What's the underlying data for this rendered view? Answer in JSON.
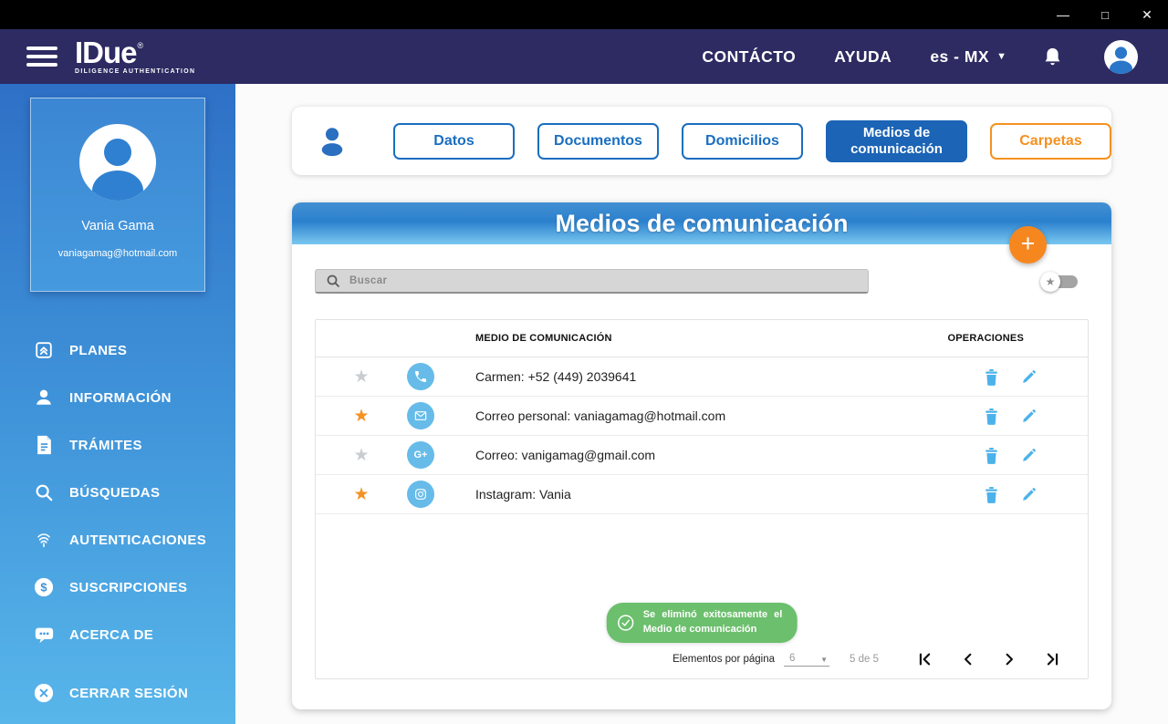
{
  "titlebar": {
    "controls": [
      {
        "name": "minimize",
        "glyph": "—"
      },
      {
        "name": "maximize",
        "glyph": "□"
      },
      {
        "name": "close",
        "glyph": "✕"
      }
    ]
  },
  "appbar": {
    "logo": {
      "title": "IDue",
      "registered": "®",
      "subtitle": "DILIGENCE AUTHENTICATION"
    },
    "nav": {
      "contact": "CONTÁCTO",
      "help": "AYUDA",
      "language": "es - MX"
    }
  },
  "sidebar": {
    "user": {
      "name": "Vania Gama",
      "email": "vaniagamag@hotmail.com"
    },
    "items": [
      {
        "label": "PLANES"
      },
      {
        "label": "INFORMACIÓN"
      },
      {
        "label": "TRÁMITES"
      },
      {
        "label": "BÚSQUEDAS"
      },
      {
        "label": "AUTENTICACIONES"
      },
      {
        "label": "SUSCRIPCIONES"
      },
      {
        "label": "ACERCA DE"
      }
    ],
    "logout": "CERRAR SESIÓN"
  },
  "tabs": [
    {
      "label": "Datos"
    },
    {
      "label": "Documentos"
    },
    {
      "label": "Domicilios"
    },
    {
      "label": "Medios de comunicación",
      "active": true
    },
    {
      "label": "Carpetas"
    }
  ],
  "panel": {
    "title": "Medios de comunicación",
    "add_button": "+",
    "search_placeholder": "Buscar",
    "table": {
      "columns": [
        "MEDIO DE COMUNICACIÓN",
        "OPERACIONES"
      ],
      "rows": [
        {
          "favorite": false,
          "icon": "phone",
          "text": "Carmen: +52 (449) 2039641"
        },
        {
          "favorite": true,
          "icon": "email",
          "text": "Correo personal:  vaniagamag@hotmail.com"
        },
        {
          "favorite": false,
          "icon": "google-plus",
          "icon_label": "G+",
          "text": "Correo: vanigamag@gmail.com"
        },
        {
          "favorite": true,
          "icon": "instagram",
          "text": "Instagram: Vania"
        }
      ]
    },
    "toast": {
      "line1": "Se eliminó exitosamente el",
      "line2": "Medio de comunicación"
    },
    "pagination": {
      "label": "Elementos por página",
      "page_size": "6",
      "range": "5 de 5"
    }
  },
  "icons": {
    "star": "★"
  },
  "colors": {
    "titlebar": "#000000",
    "appbar": "#2d2b62",
    "sidebar_top": "#2e70c6",
    "sidebar_bottom": "#58b6ea",
    "accent_blue": "#1a6ec0",
    "active_tab_blue": "#1b64b6",
    "row_icon_blue": "#66bbe9",
    "operation_blue": "#4db2ea",
    "orange": "#f6871f",
    "star_orange": "#f59120",
    "toast_green": "#6cbf6d"
  }
}
